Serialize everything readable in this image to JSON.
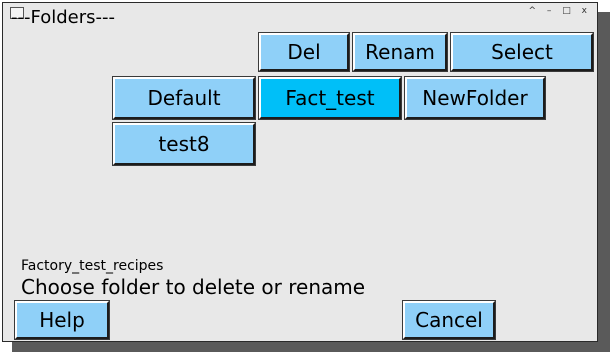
{
  "window": {
    "controls": [
      "^",
      "–",
      "□",
      "x"
    ]
  },
  "header": {
    "title": "---Folders---"
  },
  "toolbar": {
    "del_label": "Del",
    "rename_label": "Renam",
    "select_label": "Select"
  },
  "folders": [
    {
      "label": "Default",
      "selected": false
    },
    {
      "label": "Fact_test",
      "selected": true
    },
    {
      "label": "NewFolder",
      "selected": false
    },
    {
      "label": "test8",
      "selected": false
    }
  ],
  "status": {
    "current_folder": "Factory_test_recipes",
    "instruction": "Choose folder to delete or rename"
  },
  "footer": {
    "help_label": "Help",
    "cancel_label": "Cancel"
  },
  "colors": {
    "button": "#8fd0f8",
    "selected_button": "#00bff8",
    "window_bg": "#e8e8e8"
  }
}
